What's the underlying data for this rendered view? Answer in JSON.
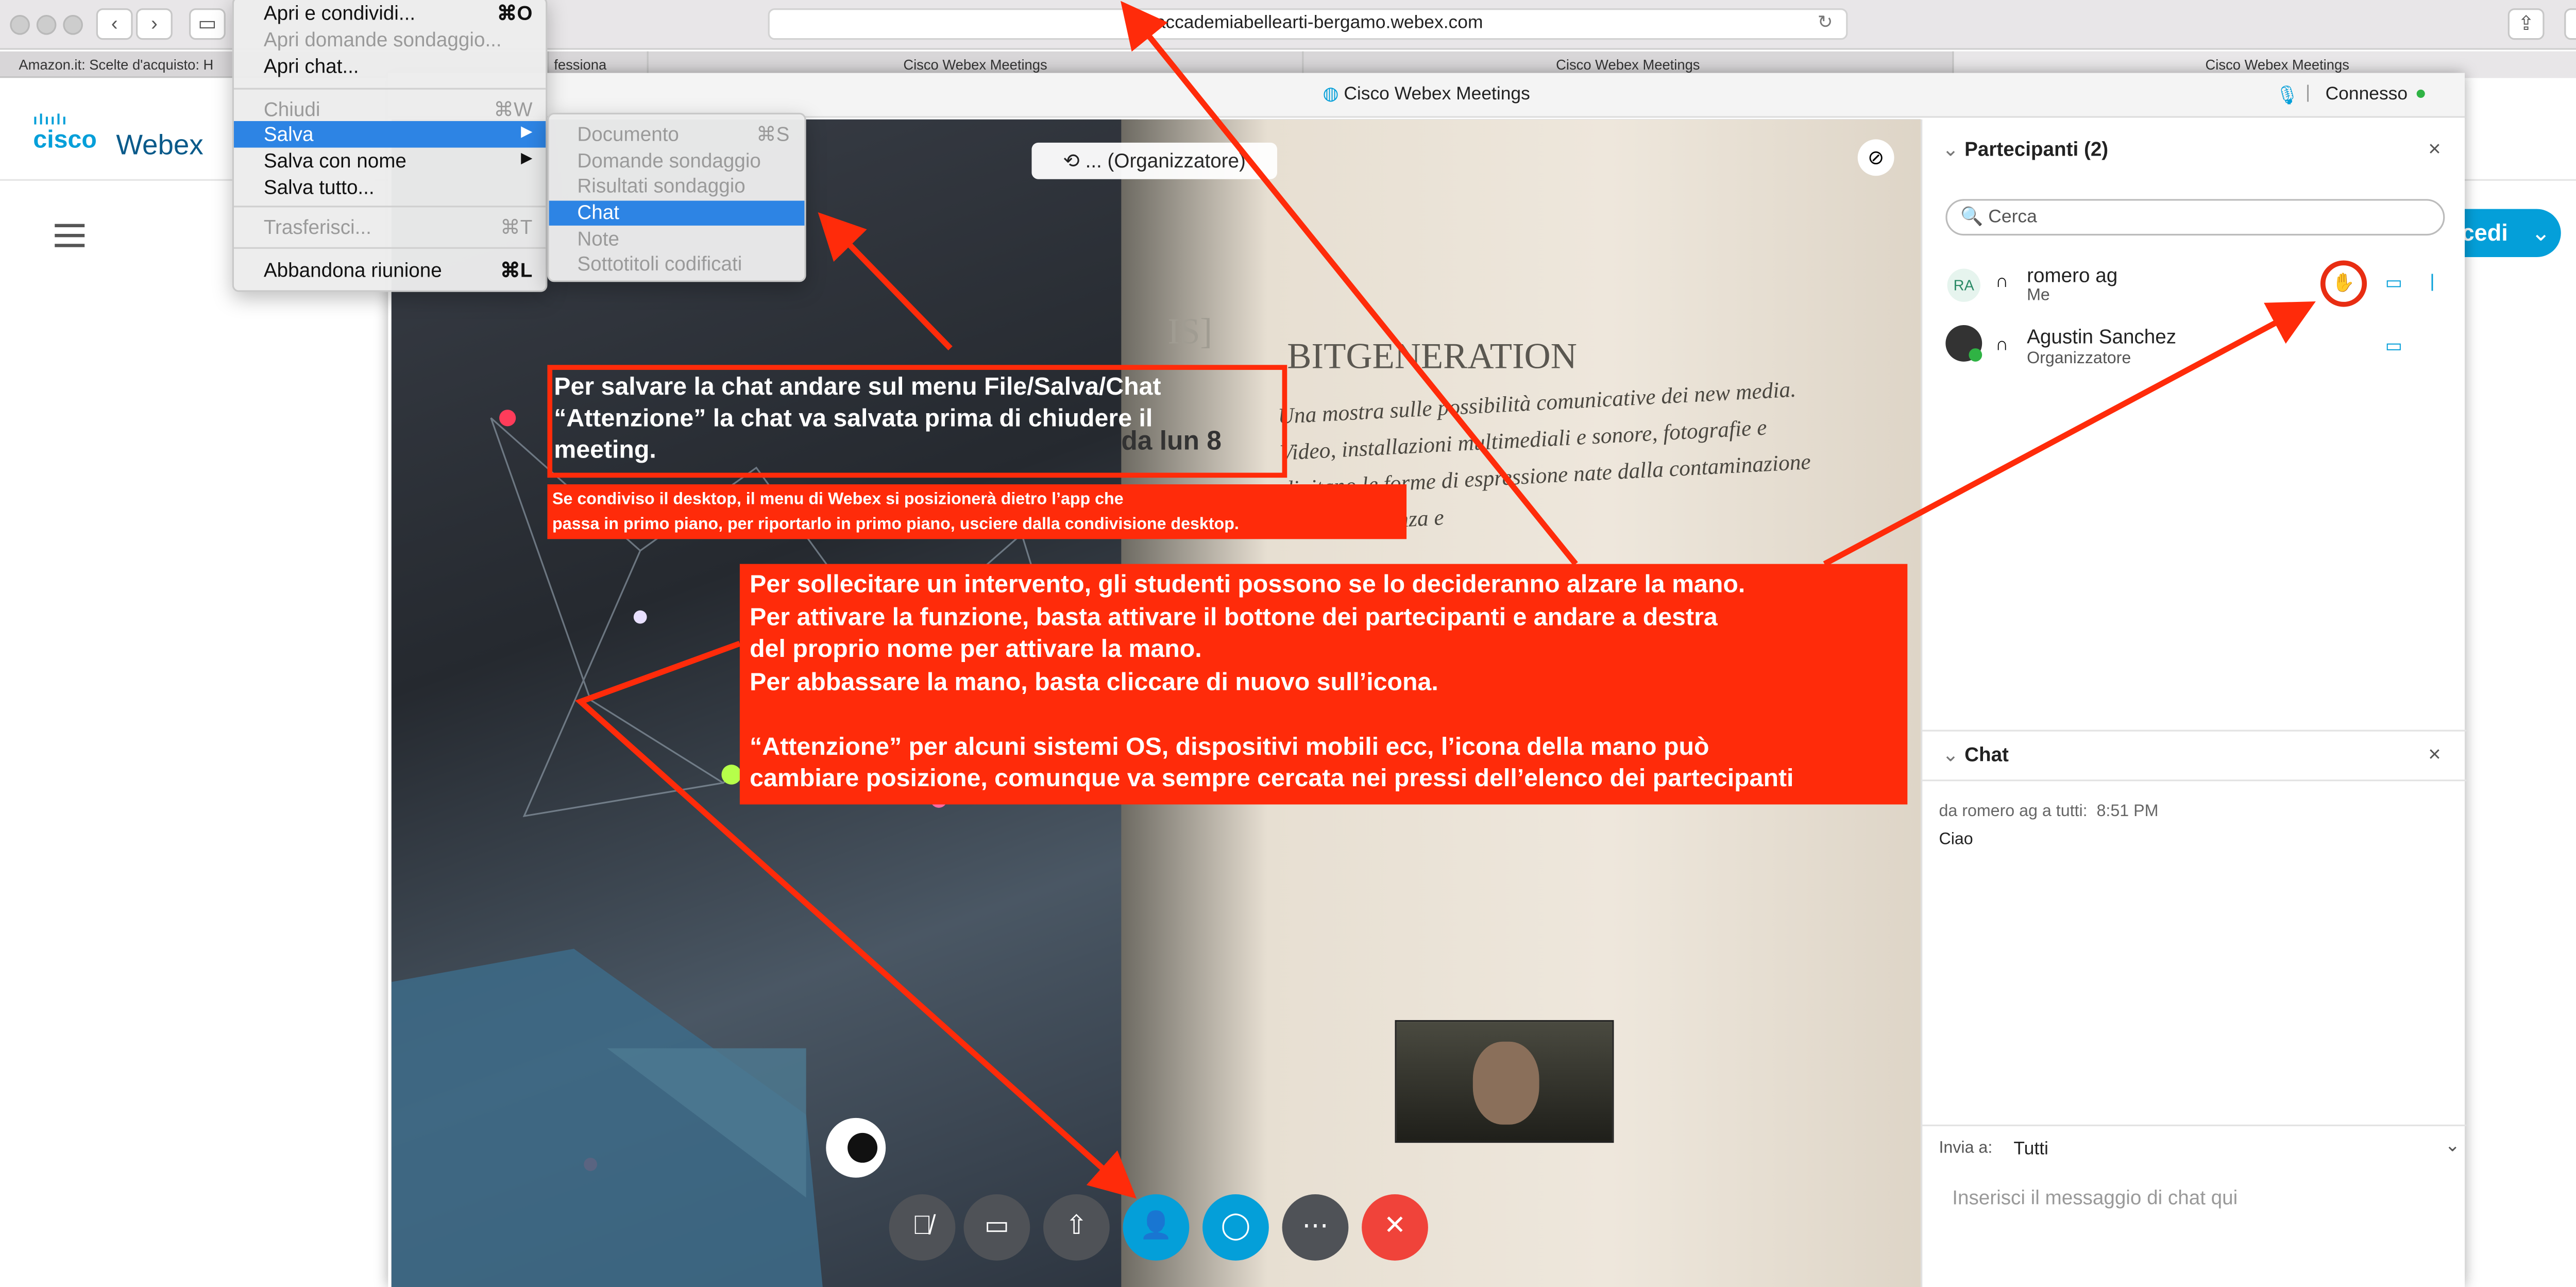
{
  "browser": {
    "url": "accademiabellearti-bergamo.webex.com",
    "bookmark": "Amazon.it: Scelte d'acquisto: H",
    "tabs": [
      "fessiona",
      "Cisco Webex Meetings",
      "Cisco Webex Meetings",
      "Cisco Webex Meetings"
    ]
  },
  "menu": {
    "items": [
      "Apri e condividi...",
      "Apri domande sondaggio...",
      "Apri chat...",
      "Chiudi",
      "Salva",
      "Salva con nome",
      "Salva tutto...",
      "Trasferisci...",
      "Abbandona riunione"
    ],
    "shortcuts": {
      "apri": "⌘O",
      "chiudi": "⌘W",
      "trasferisci": "⌘T",
      "abbandona": "⌘L"
    },
    "submenu": [
      "Documento",
      "Domande sondaggio",
      "Risultati sondaggio",
      "Chat",
      "Note",
      "Sottotitoli codificati"
    ],
    "submenu_shortcut": "⌘S"
  },
  "page": {
    "brand_cisco": "cisco",
    "brand_webex": "Webex",
    "join_label": "cedi"
  },
  "window": {
    "title": "Cisco Webex Meetings",
    "status": "Connesso"
  },
  "video": {
    "host_label": "... (Organizzatore)",
    "bg_caption": "BITGENERATION",
    "bg_date": "da lun 8",
    "bg_text": "Una mostra sulle possibilità comunicative dei new media. Video, installazioni multimediali e sonore, fotografie e digitano le forme di espressione nate dalla contaminazione tra arte, scienza e"
  },
  "annotations": {
    "a1": [
      "Per salvare la chat andare sul menu File/Salva/Chat",
      "“Attenzione” la chat va salvata prima di chiudere il",
      "meeting."
    ],
    "a2": [
      "Se condiviso il desktop, il menu di Webex si posizionerà dietro l’app che",
      "passa in primo piano, per riportarlo in primo piano, usciere dalla condivisione desktop."
    ],
    "a3": [
      "Per sollecitare un intervento,  gli studenti possono se lo decideranno alzare la mano.",
      "Per attivare la funzione, basta attivare il bottone dei partecipanti e andare a destra",
      "del proprio nome per attivare la mano.",
      "Per abbassare la mano, basta cliccare di nuovo sull’icona.",
      "",
      "“Attenzione” per alcuni sistemi OS, dispositivi mobili ecc, l’icona della mano può",
      "cambiare posizione, comunque va sempre cercata nei pressi dell’elenco dei partecipanti"
    ]
  },
  "participants": {
    "header": "Partecipanti (2)",
    "search_placeholder": "Cerca",
    "list": [
      {
        "initials": "RA",
        "name": "romero ag",
        "role": "Me"
      },
      {
        "name": "Agustin Sanchez",
        "role": "Organizzatore"
      }
    ]
  },
  "chat": {
    "header": "Chat",
    "meta": "da romero ag a tutti:",
    "time": "8:51 PM",
    "message": "Ciao",
    "send_to_label": "Invia a:",
    "send_to_value": "Tutti",
    "input_placeholder": "Inserisci il messaggio di chat qui"
  },
  "colors": {
    "accent": "#049fd9",
    "annotation": "#ff2b0a",
    "green": "#2fb344",
    "end": "#f0433a"
  }
}
